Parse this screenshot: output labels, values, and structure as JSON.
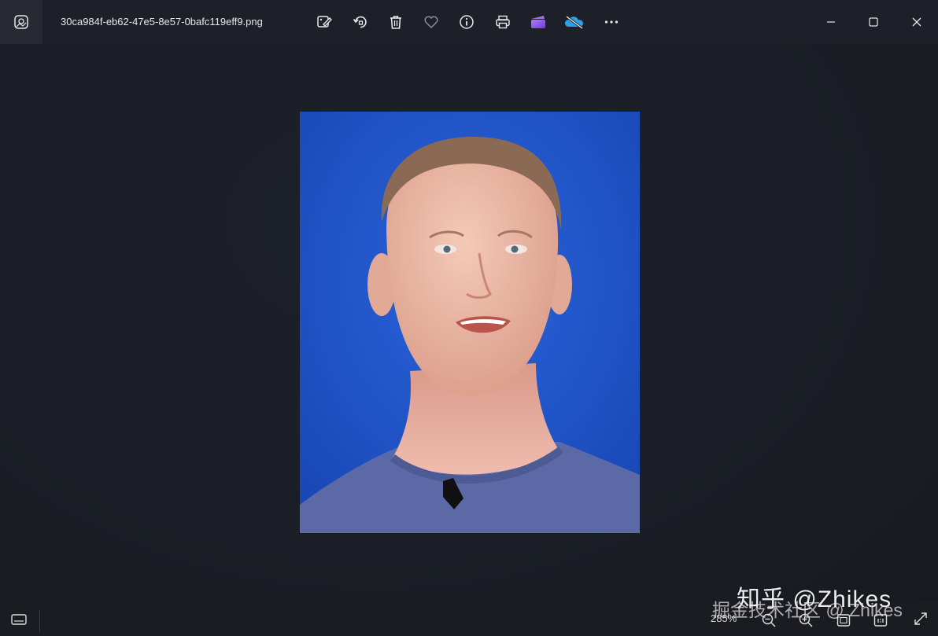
{
  "window": {
    "filename": "30ca984f-eb62-47e5-8e57-0bafc119eff9.png"
  },
  "toolbar": {
    "buttons": [
      {
        "icon": "edit-image-icon"
      },
      {
        "icon": "rotate-icon"
      },
      {
        "icon": "delete-icon"
      },
      {
        "icon": "favorite-heart-icon"
      },
      {
        "icon": "info-icon"
      },
      {
        "icon": "print-icon"
      },
      {
        "icon": "clipchamp-icon"
      },
      {
        "icon": "onedrive-icon"
      },
      {
        "icon": "more-options-icon"
      }
    ]
  },
  "window_controls": [
    "minimize-icon",
    "maximize-icon",
    "close-icon"
  ],
  "statusbar": {
    "zoom": "285%"
  },
  "watermark": {
    "line1": "知乎 @Zhikes",
    "line2": "掘金技术社区 @ Zhikes"
  },
  "colors": {
    "background": "#1c1f27",
    "photo_background": "#1f53c4",
    "shirt": "#5b6aa6",
    "skin": "#e9b8a6"
  }
}
